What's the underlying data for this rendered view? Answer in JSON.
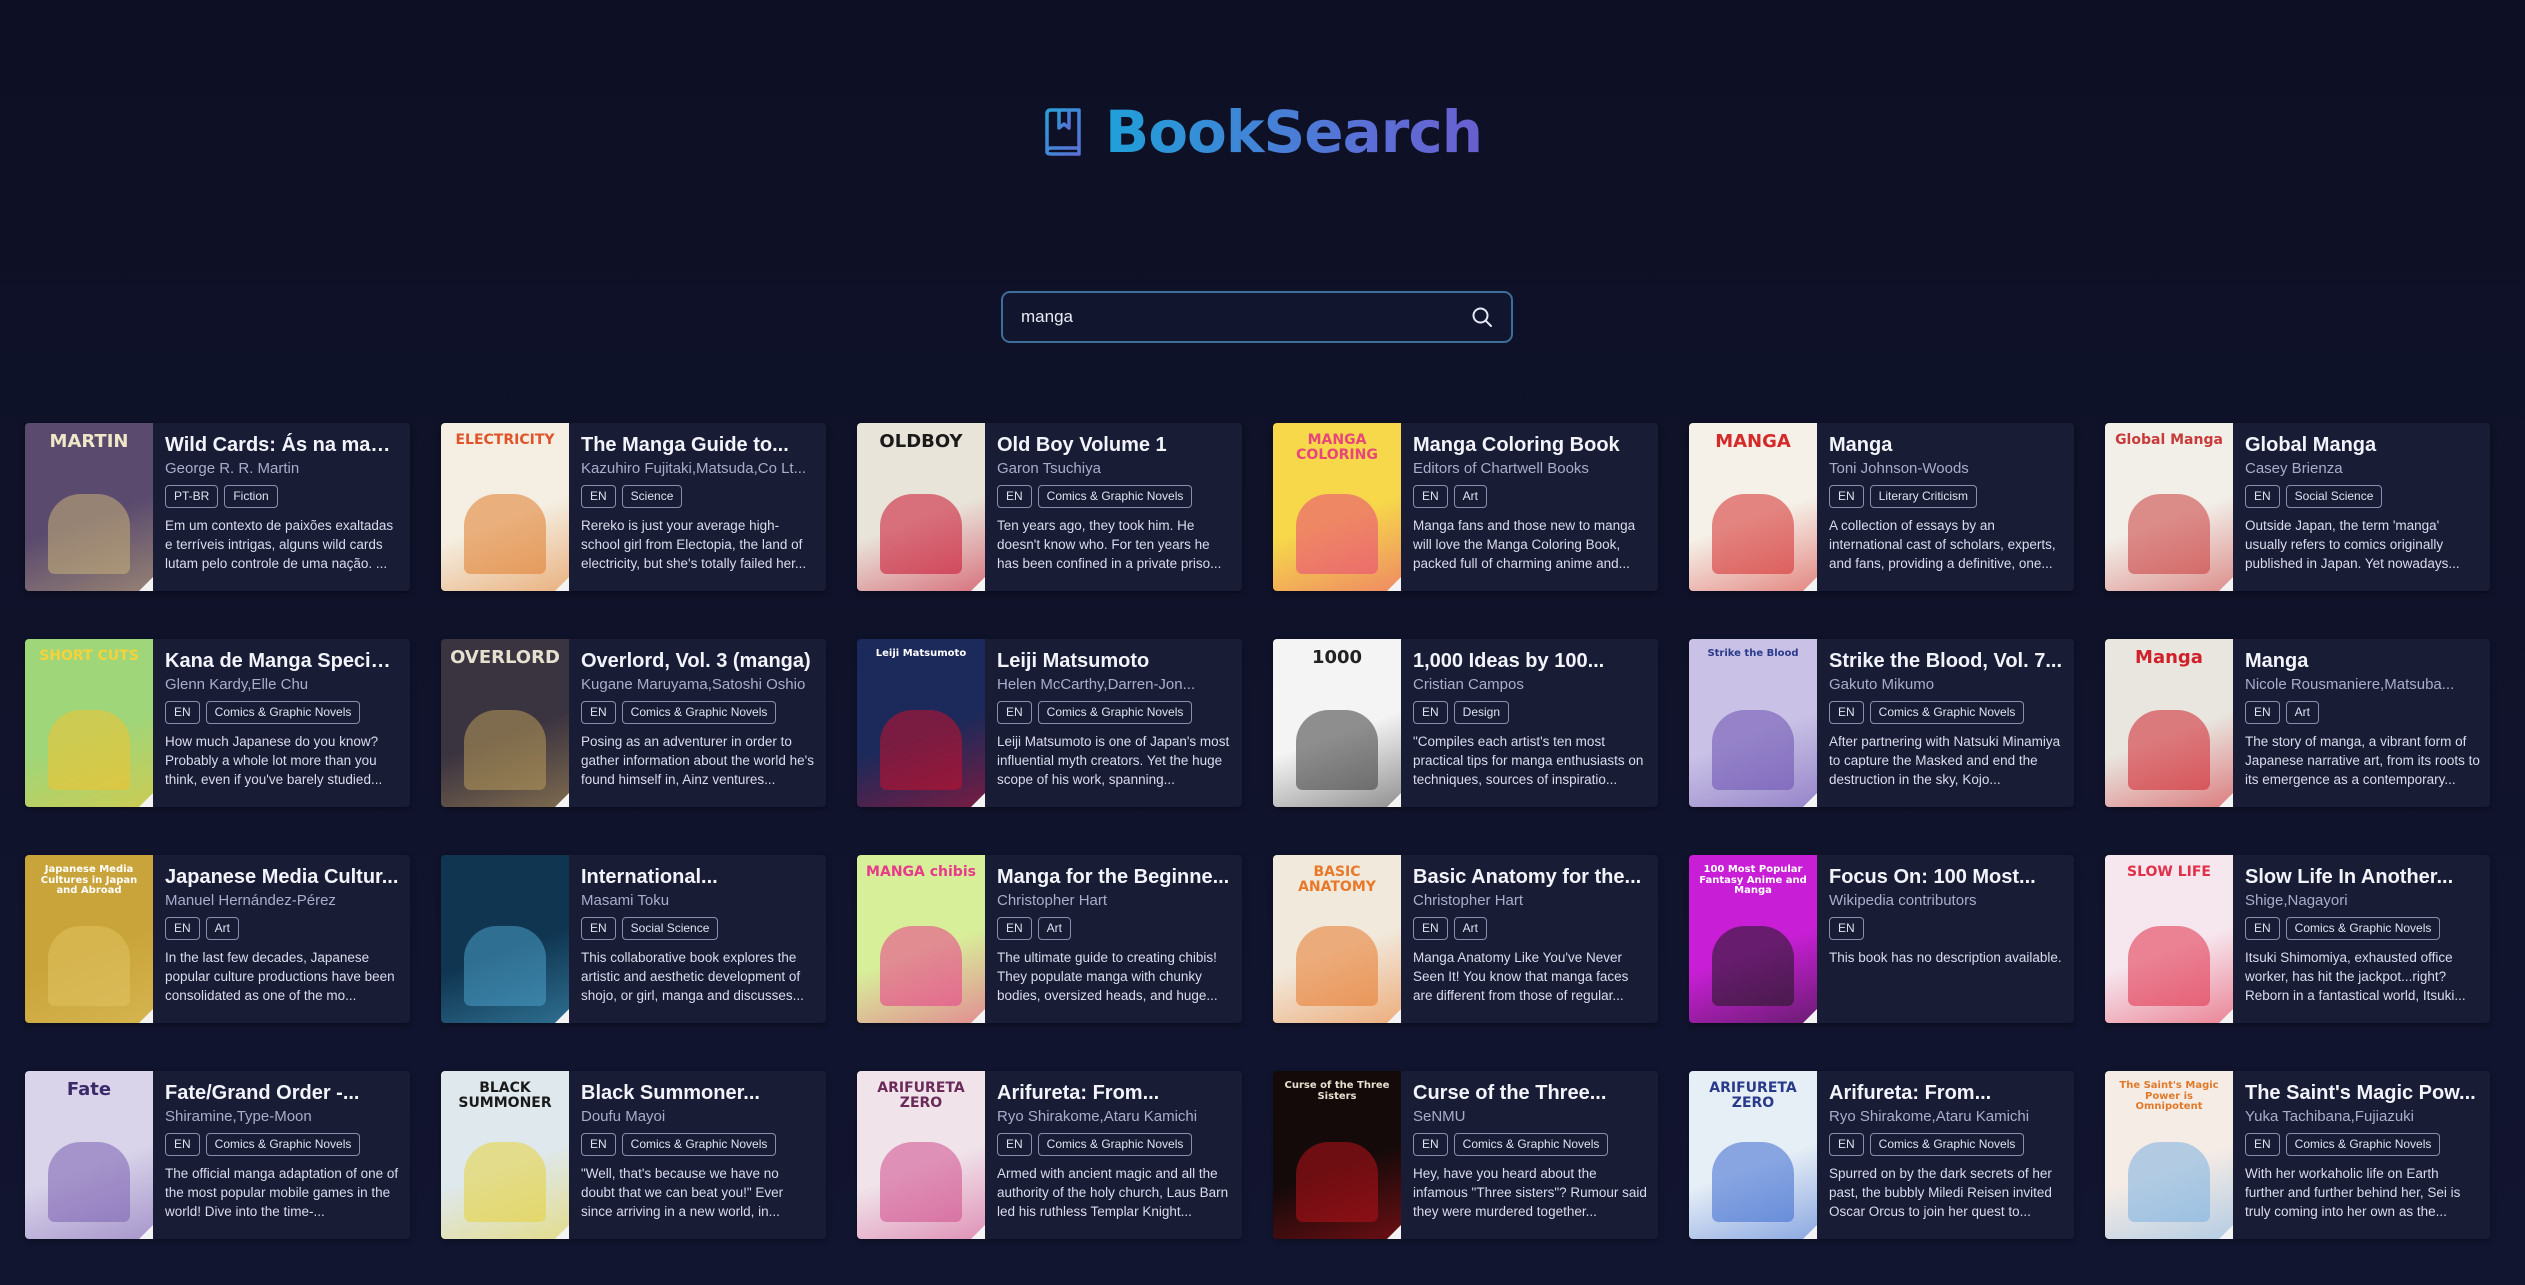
{
  "app": {
    "title": "BookSearch",
    "brand_gradient": [
      "#1fa0d8",
      "#6a5fd0"
    ],
    "logo_icon": "book-bookmark-icon"
  },
  "search": {
    "value": "manga",
    "placeholder": "",
    "button_icon": "search-icon"
  },
  "books": [
    {
      "title": "Wild Cards: Ás na manga",
      "authors": "George R. R. Martin",
      "tags": [
        "PT-BR",
        "Fiction"
      ],
      "description": "Em um contexto de paixões exaltadas e terríveis intrigas, alguns wild cards lutam pelo controle de uma nação. ...",
      "cover_bg": "#5a4a6e",
      "cover_accent": "#c9b27a",
      "cover_text": "MARTIN",
      "cover_text_color": "#f0e6c8"
    },
    {
      "title": "The Manga Guide to...",
      "authors": "Kazuhiro Fujitaki,Matsuda,Co Lt...",
      "tags": [
        "EN",
        "Science"
      ],
      "description": "Rereko is just your average high-school girl from Electopia, the land of electricity, but she's totally failed her...",
      "cover_bg": "#f4efe2",
      "cover_accent": "#e07b2a",
      "cover_text": "ELECTRICITY",
      "cover_text_color": "#e0542a"
    },
    {
      "title": "Old Boy Volume 1",
      "authors": "Garon Tsuchiya",
      "tags": [
        "EN",
        "Comics & Graphic Novels"
      ],
      "description": "Ten years ago, they took him. He doesn't know who. For ten years he has been confined in a private priso...",
      "cover_bg": "#e9e4da",
      "cover_accent": "#c8102e",
      "cover_text": "OLDBOY",
      "cover_text_color": "#1a1a1a"
    },
    {
      "title": "Manga Coloring Book",
      "authors": "Editors of Chartwell Books",
      "tags": [
        "EN",
        "Art"
      ],
      "description": "Manga fans and those new to manga will love the Manga Coloring Book, packed full of charming anime and...",
      "cover_bg": "#f6d84a",
      "cover_accent": "#e8457a",
      "cover_text": "MANGA COLORING",
      "cover_text_color": "#e8457a"
    },
    {
      "title": "Manga",
      "authors": "Toni Johnson-Woods",
      "tags": [
        "EN",
        "Literary Criticism"
      ],
      "description": "A collection of essays by an international cast of scholars, experts, and fans, providing a definitive, one...",
      "cover_bg": "#f5f1e8",
      "cover_accent": "#d42a2a",
      "cover_text": "MANGA",
      "cover_text_color": "#d42a2a"
    },
    {
      "title": "Global Manga",
      "authors": "Casey Brienza",
      "tags": [
        "EN",
        "Social Science"
      ],
      "description": "Outside Japan, the term 'manga' usually refers to comics originally published in Japan. Yet nowadays...",
      "cover_bg": "#f2efe9",
      "cover_accent": "#c93a3a",
      "cover_text": "Global Manga",
      "cover_text_color": "#c93a3a"
    },
    {
      "title": "Kana de Manga Special...",
      "authors": "Glenn Kardy,Elle Chu",
      "tags": [
        "EN",
        "Comics & Graphic Novels"
      ],
      "description": "How much Japanese do you know? Probably a whole lot more than you think, even if you've barely studied...",
      "cover_bg": "#9fd67a",
      "cover_accent": "#f2c230",
      "cover_text": "SHORT CUTS",
      "cover_text_color": "#f7d23a"
    },
    {
      "title": "Overlord, Vol. 3 (manga)",
      "authors": "Kugane Maruyama,Satoshi Oshio",
      "tags": [
        "EN",
        "Comics & Graphic Novels"
      ],
      "description": "Posing as an adventurer in order to gather information about the world he's found himself in, Ainz ventures...",
      "cover_bg": "#3a3340",
      "cover_accent": "#b89a5a",
      "cover_text": "OVERLORD",
      "cover_text_color": "#e6e0d0"
    },
    {
      "title": "Leiji Matsumoto",
      "authors": "Helen McCarthy,Darren-Jon...",
      "tags": [
        "EN",
        "Comics & Graphic Novels"
      ],
      "description": "Leiji Matsumoto is one of Japan's most influential myth creators. Yet the huge scope of his work, spanning...",
      "cover_bg": "#1b2a5a",
      "cover_accent": "#c8102e",
      "cover_text": "Leiji Matsumoto",
      "cover_text_color": "#ffffff"
    },
    {
      "title": "1,000 Ideas by 100...",
      "authors": "Cristian Campos",
      "tags": [
        "EN",
        "Design"
      ],
      "description": "\"Compiles each artist's ten most practical tips for manga enthusiasts on techniques, sources of inspiratio...",
      "cover_bg": "#f4f4f4",
      "cover_accent": "#3a3a3a",
      "cover_text": "1000",
      "cover_text_color": "#222222"
    },
    {
      "title": "Strike the Blood, Vol. 7...",
      "authors": "Gakuto Mikumo",
      "tags": [
        "EN",
        "Comics & Graphic Novels"
      ],
      "description": "After partnering with Natsuki Minamiya to capture the Masked and end the destruction in the sky, Kojo...",
      "cover_bg": "#c9c2e6",
      "cover_accent": "#6a4fb0",
      "cover_text": "Strike the Blood",
      "cover_text_color": "#2a3a8a"
    },
    {
      "title": "Manga",
      "authors": "Nicole Rousmaniere,Matsuba...",
      "tags": [
        "EN",
        "Art"
      ],
      "description": "The story of manga, a vibrant form of Japanese narrative art, from its roots to its emergence as a contemporary...",
      "cover_bg": "#e9e6e0",
      "cover_accent": "#d0212a",
      "cover_text": "Manga",
      "cover_text_color": "#d0212a"
    },
    {
      "title": "Japanese Media Cultur...",
      "authors": "Manuel Hernández-Pérez",
      "tags": [
        "EN",
        "Art"
      ],
      "description": "In the last few decades, Japanese popular culture productions have been consolidated as one of the mo...",
      "cover_bg": "#c9a43a",
      "cover_accent": "#e0c260",
      "cover_text": "Japanese Media Cultures in Japan and Abroad",
      "cover_text_color": "#ffffff"
    },
    {
      "title": "International...",
      "authors": "Masami Toku",
      "tags": [
        "EN",
        "Social Science"
      ],
      "description": "This collaborative book explores the artistic and aesthetic development of shojo, or girl, manga and discusses...",
      "cover_bg": "#0f3550",
      "cover_accent": "#4aa0c8",
      "cover_text": "",
      "cover_text_color": "#ffffff"
    },
    {
      "title": "Manga for the Beginne...",
      "authors": "Christopher Hart",
      "tags": [
        "EN",
        "Art"
      ],
      "description": "The ultimate guide to creating chibis! They populate manga with chunky bodies, oversized heads, and huge...",
      "cover_bg": "#d8ef9a",
      "cover_accent": "#e83a8a",
      "cover_text": "MANGA chibis",
      "cover_text_color": "#e83a8a"
    },
    {
      "title": "Basic Anatomy for the...",
      "authors": "Christopher Hart",
      "tags": [
        "EN",
        "Art"
      ],
      "description": "Manga Anatomy Like You've Never Seen It! You know that manga faces are different from those of regular...",
      "cover_bg": "#f1e9dc",
      "cover_accent": "#e8792a",
      "cover_text": "BASIC ANATOMY",
      "cover_text_color": "#e8792a"
    },
    {
      "title": "Focus On: 100 Most...",
      "authors": "Wikipedia contributors",
      "tags": [
        "EN"
      ],
      "description": "This book has no description available.",
      "cover_bg": "#c81fd6",
      "cover_accent": "#1a1a1a",
      "cover_text": "100 Most Popular Fantasy Anime and Manga",
      "cover_text_color": "#ffffff"
    },
    {
      "title": "Slow Life In Another...",
      "authors": "Shige,Nagayori",
      "tags": [
        "EN",
        "Comics & Graphic Novels"
      ],
      "description": "Itsuki Shimomiya, exhausted office worker, has hit the jackpot...right? Reborn in a fantastical world, Itsuki...",
      "cover_bg": "#f6e6ee",
      "cover_accent": "#e0304a",
      "cover_text": "SLOW LIFE",
      "cover_text_color": "#e0304a"
    },
    {
      "title": "Fate/Grand Order -...",
      "authors": "Shiramine,Type-Moon",
      "tags": [
        "EN",
        "Comics & Graphic Novels"
      ],
      "description": "The official manga adaptation of one of the most popular mobile games in the world! Dive into the time-...",
      "cover_bg": "#d9d4ea",
      "cover_accent": "#7a5fb0",
      "cover_text": "Fate",
      "cover_text_color": "#3a2a6a"
    },
    {
      "title": "Black Summoner...",
      "authors": "Doufu Mayoi",
      "tags": [
        "EN",
        "Comics & Graphic Novels"
      ],
      "description": "\"Well, that's because we have no doubt that we can beat you!\" Ever since arriving in a new world, in...",
      "cover_bg": "#dfe8ec",
      "cover_accent": "#e6d23a",
      "cover_text": "BLACK SUMMONER",
      "cover_text_color": "#1a1a1a"
    },
    {
      "title": "Arifureta: From...",
      "authors": "Ryo Shirakome,Ataru Kamichi",
      "tags": [
        "EN",
        "Comics & Graphic Novels"
      ],
      "description": "Armed with ancient magic and all the authority of the holy church, Laus Barn led his ruthless Templar Knight...",
      "cover_bg": "#f0e4ea",
      "cover_accent": "#d04a8a",
      "cover_text": "ARIFURETA ZERO",
      "cover_text_color": "#6a2a5a"
    },
    {
      "title": "Curse of the Three...",
      "authors": "SeNMU",
      "tags": [
        "EN",
        "Comics & Graphic Novels"
      ],
      "description": "Hey, have you heard about the infamous \"Three sisters\"? Rumour said they were murdered together...",
      "cover_bg": "#140a0a",
      "cover_accent": "#b8121a",
      "cover_text": "Curse of the Three Sisters",
      "cover_text_color": "#e8e0d0"
    },
    {
      "title": "Arifureta: From...",
      "authors": "Ryo Shirakome,Ataru Kamichi",
      "tags": [
        "EN",
        "Comics & Graphic Novels"
      ],
      "description": "Spurred on by the dark secrets of her past, the bubbly Miledi Reisen invited Oscar Orcus to join her quest to...",
      "cover_bg": "#e6eef6",
      "cover_accent": "#3a6ad0",
      "cover_text": "ARIFURETA ZERO",
      "cover_text_color": "#2a3a8a"
    },
    {
      "title": "The Saint's Magic Pow...",
      "authors": "Yuka Tachibana,Fujiazuki",
      "tags": [
        "EN",
        "Comics & Graphic Novels"
      ],
      "description": "With her workaholic life on Earth further and further behind her, Sei is truly coming into her own as the...",
      "cover_bg": "#f6ece6",
      "cover_accent": "#7ab0e0",
      "cover_text": "The Saint's Magic Power is Omnipotent",
      "cover_text_color": "#e07a2a"
    }
  ]
}
